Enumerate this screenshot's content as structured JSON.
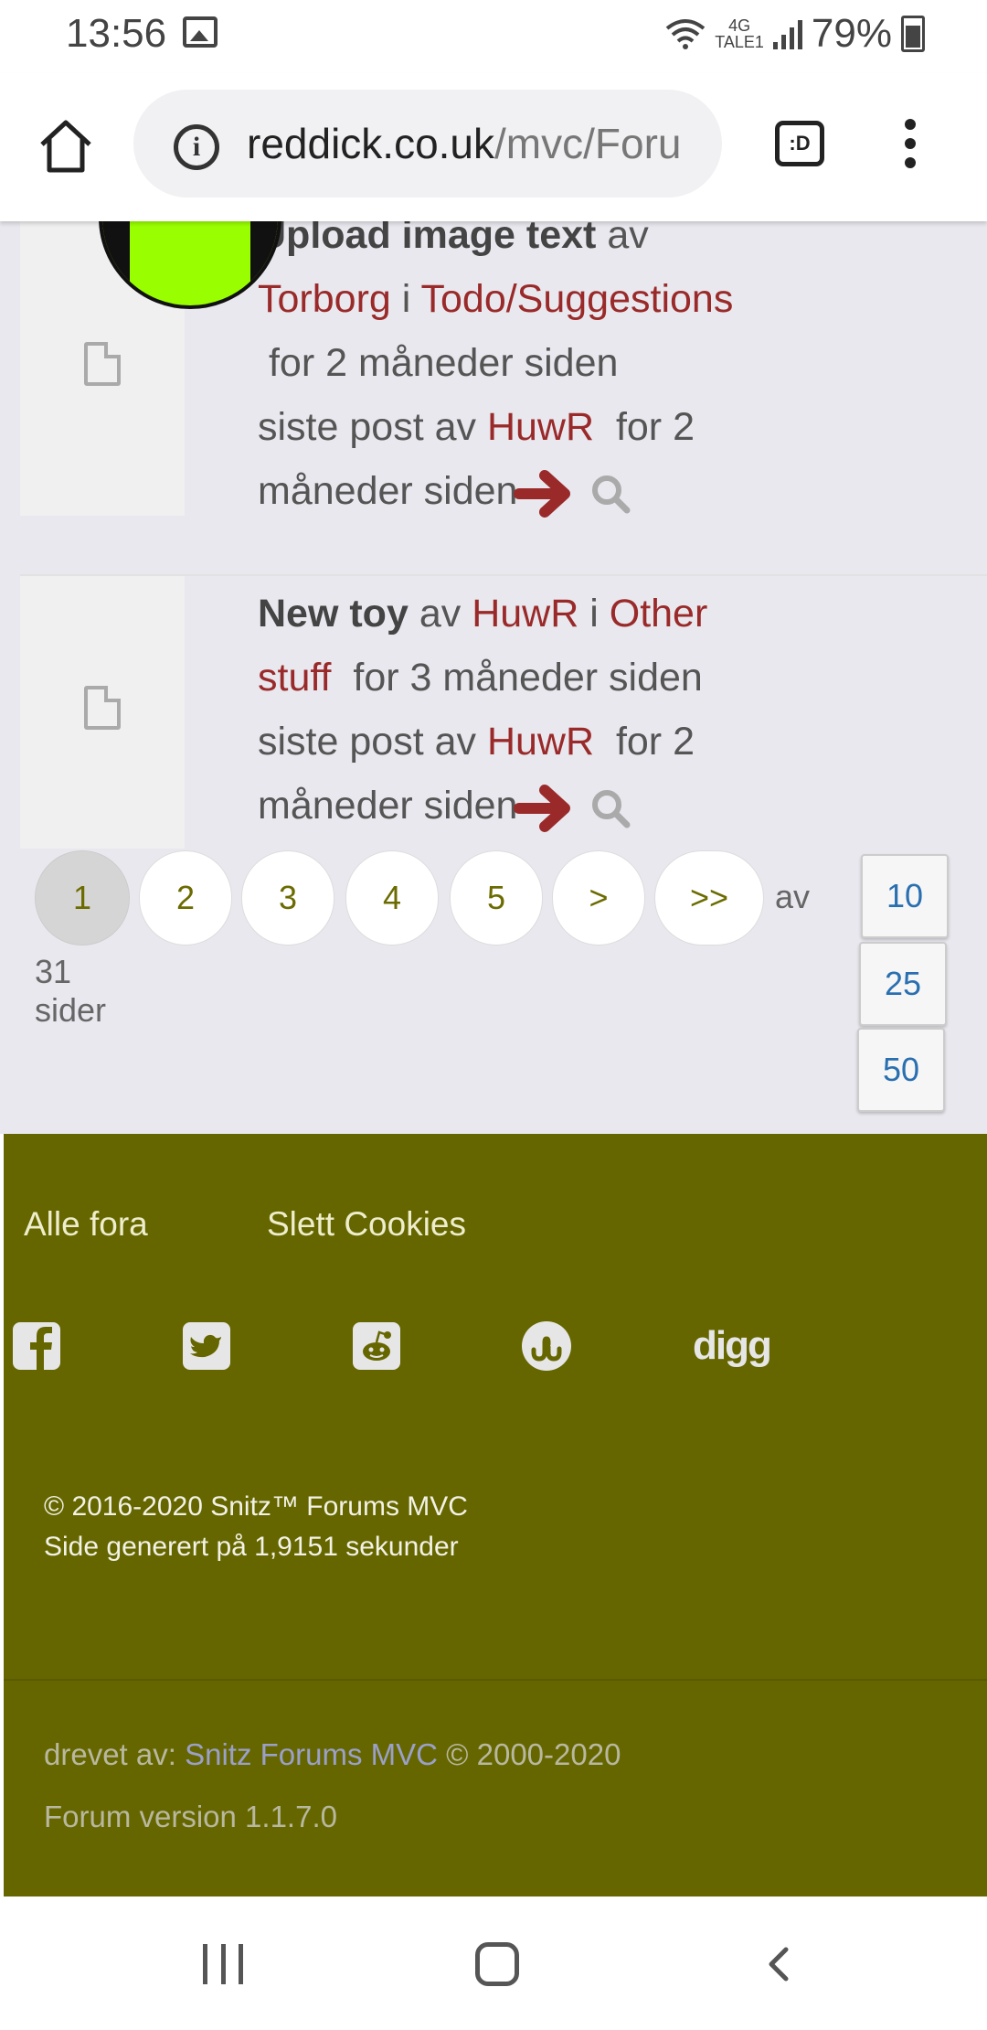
{
  "status_bar": {
    "time": "13:56",
    "network_top": "4G",
    "network_bottom": "TALE1",
    "battery": "79%"
  },
  "browser": {
    "url_domain": "reddick.co.uk",
    "url_path": "/mvc/Foru",
    "tab_switcher_label": ":D"
  },
  "topics": [
    {
      "title": "Upload image text",
      "by": "av",
      "author": "Torborg",
      "in": "i",
      "forum": "Todo/Suggestions",
      "age": "for 2 måneder siden",
      "last_post_prefix": "siste post av",
      "last_author": "HuwR",
      "last_age_1": "for 2",
      "last_age_2": "måneder siden"
    },
    {
      "title": "New toy",
      "by": "av",
      "author": "HuwR",
      "in": "i",
      "forum_1": "Other",
      "forum_2": "stuff",
      "age": "for 3 måneder siden",
      "last_post_prefix": "siste post av",
      "last_author": "HuwR",
      "last_age_1": "for 2",
      "last_age_2": "måneder siden"
    }
  ],
  "pagination": {
    "pages": [
      "1",
      "2",
      "3",
      "4",
      "5",
      ">",
      ">>"
    ],
    "current": "1",
    "of_label": "av",
    "total_label": "31 sider",
    "page_sizes": [
      "10",
      "25",
      "50"
    ]
  },
  "footer": {
    "links": [
      "Alle fora",
      "Slett Cookies"
    ],
    "social_icons": [
      "facebook-icon",
      "twitter-icon",
      "reddit-icon",
      "stumbleupon-icon",
      "digg-icon"
    ],
    "digg_label": "digg",
    "copyright": "© 2016-2020 Snitz™ Forums MVC",
    "generated": "Side generert på 1,9151 sekunder",
    "powered_prefix": "drevet av:",
    "powered_link": "Snitz Forums MVC",
    "powered_suffix": "© 2000-2020",
    "version": "Forum version 1.1.7.0"
  },
  "colors": {
    "link": "#9a2a2a",
    "footer_bg": "#666600",
    "page_bg": "#e8e8ee",
    "pager_text": "#6b6b00",
    "size_text": "#2a6fb0",
    "arrow": "#9a2a2a"
  }
}
